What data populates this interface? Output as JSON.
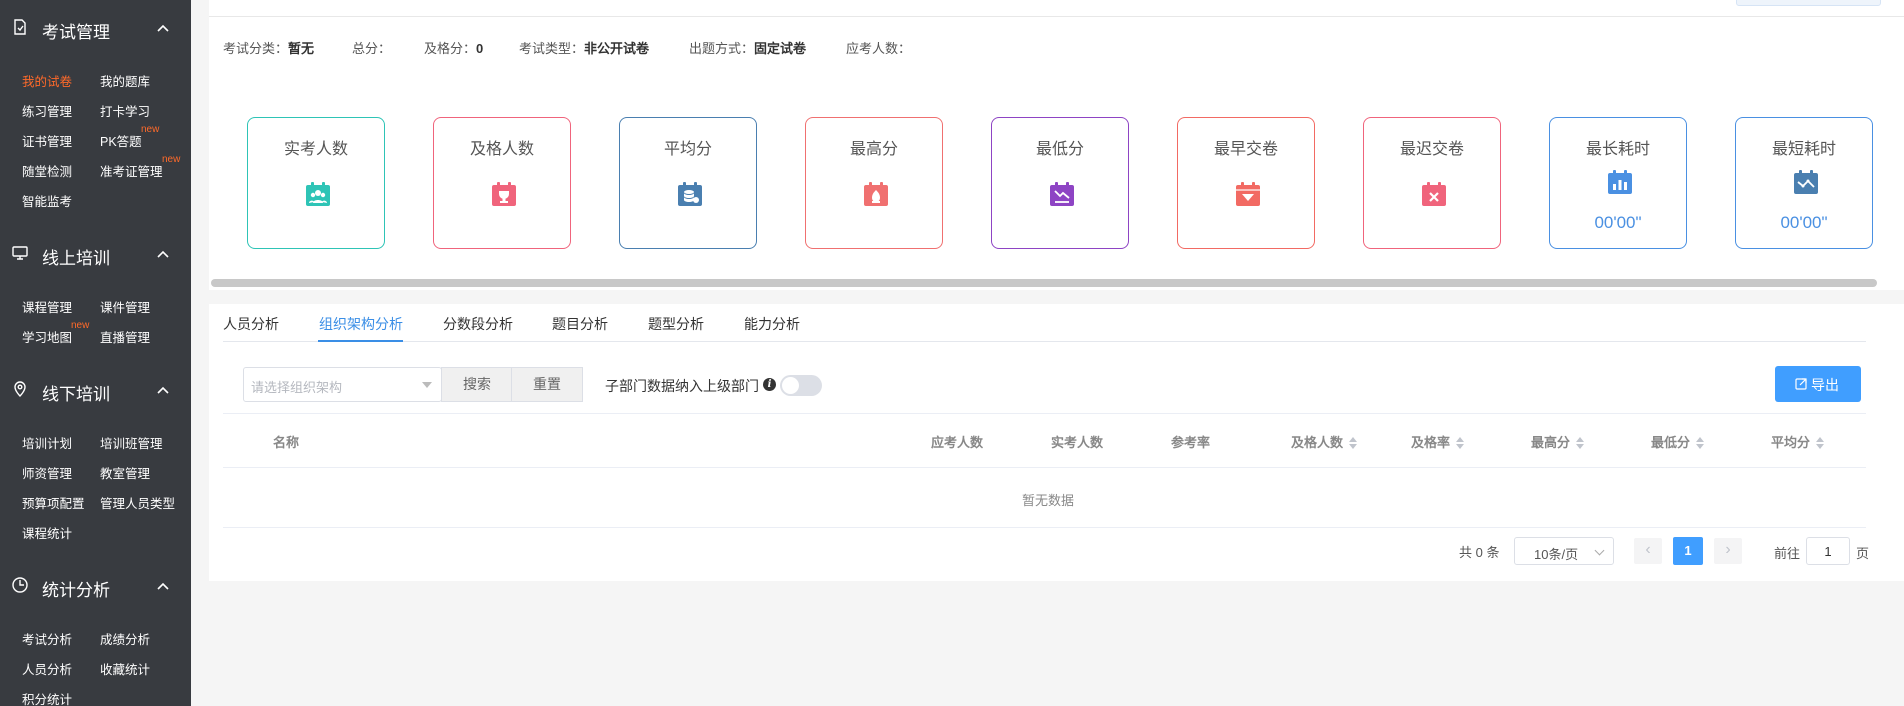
{
  "sidebar": {
    "sections": [
      {
        "title": "考试管理",
        "icon": "doc-icon"
      },
      {
        "title": "线上培训",
        "icon": "monitor-icon"
      },
      {
        "title": "线下培训",
        "icon": "location-icon"
      },
      {
        "title": "统计分析",
        "icon": "clock-icon"
      }
    ],
    "exam_items": [
      "我的试卷",
      "我的题库",
      "练习管理",
      "打卡学习",
      "证书管理",
      "PK答题",
      "随堂检测",
      "准考证管理",
      "智能监考"
    ],
    "online_items": [
      "课程管理",
      "课件管理",
      "学习地图",
      "直播管理"
    ],
    "offline_items": [
      "培训计划",
      "培训班管理",
      "师资管理",
      "教室管理",
      "预算项配置",
      "管理人员类型",
      "课程统计"
    ],
    "stats_items": [
      "考试分析",
      "成绩分析",
      "人员分析",
      "收藏统计",
      "积分统计"
    ],
    "new_badge": "new",
    "accent_color": "#ff6a2a"
  },
  "info": {
    "category_label": "考试分类：",
    "category_value": "暂无",
    "total_label": "总分：",
    "total_value": "",
    "pass_label": "及格分：",
    "pass_value": "0",
    "type_label": "考试类型：",
    "type_value": "非公开试卷",
    "method_label": "出题方式：",
    "method_value": "固定试卷",
    "expected_label": "应考人数：",
    "expected_value": ""
  },
  "stats": [
    {
      "label": "实考人数",
      "icon": "people-icon",
      "color": "#2ec4b6"
    },
    {
      "label": "及格人数",
      "icon": "trophy-icon",
      "color": "#f0647c"
    },
    {
      "label": "平均分",
      "icon": "database-icon",
      "color": "#4a7fb0"
    },
    {
      "label": "最高分",
      "icon": "fire-icon",
      "color": "#f07070"
    },
    {
      "label": "最低分",
      "icon": "chart-down-icon",
      "color": "#8e44c4"
    },
    {
      "label": "最早交卷",
      "icon": "arrow-down-icon",
      "color": "#f26a63"
    },
    {
      "label": "最迟交卷",
      "icon": "close-icon",
      "color": "#f0647c"
    },
    {
      "label": "最长耗时",
      "icon": "bar-chart-icon",
      "color": "#4a90e2",
      "value": "00'00\""
    },
    {
      "label": "最短耗时",
      "icon": "trend-icon",
      "color": "#4a90e2",
      "value": "00'00\""
    }
  ],
  "tabs": [
    "人员分析",
    "组织架构分析",
    "分数段分析",
    "题目分析",
    "题型分析",
    "能力分析"
  ],
  "active_tab": "组织架构分析",
  "filter": {
    "org_placeholder": "请选择组织架构",
    "search_label": "搜索",
    "reset_label": "重置",
    "sub_dept_label": "子部门数据纳入上级部门",
    "info_glyph": "i",
    "export_label": "导出"
  },
  "table": {
    "columns": [
      "名称",
      "应考人数",
      "实考人数",
      "参考率",
      "及格人数",
      "及格率",
      "最高分",
      "最低分",
      "平均分"
    ],
    "empty_text": "暂无数据"
  },
  "pagination": {
    "total_text": "共 0 条",
    "page_size": "10条/页",
    "current_page": "1",
    "goto_label": "前往",
    "goto_value": "1",
    "goto_suffix": "页",
    "prev": "‹",
    "next": "›"
  },
  "colors": {
    "primary": "#409eff",
    "sidebar_bg": "#383b40"
  }
}
